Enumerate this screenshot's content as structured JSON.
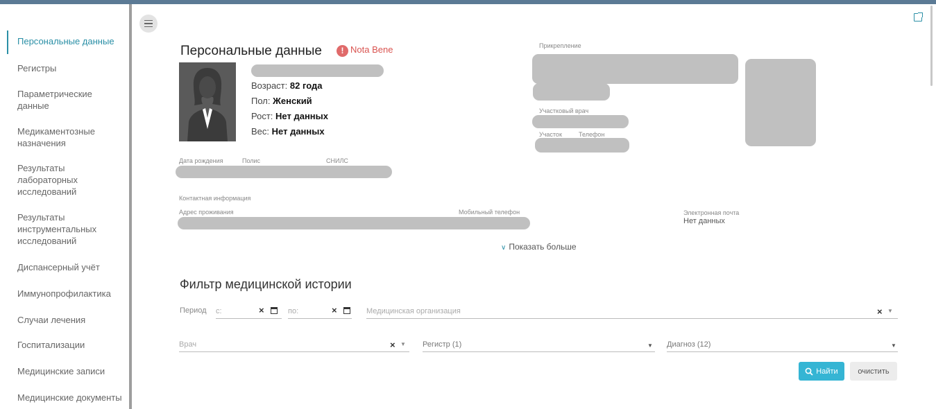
{
  "sidebar": {
    "items": [
      {
        "label": "Персональные данные"
      },
      {
        "label": "Регистры"
      },
      {
        "label": "Параметрические данные"
      },
      {
        "label": "Медикаментозные назначения"
      },
      {
        "label": "Результаты лабораторных исследований"
      },
      {
        "label": "Результаты инструментальных исследований"
      },
      {
        "label": "Диспансерный учёт"
      },
      {
        "label": "Иммунопрофилактика"
      },
      {
        "label": "Случаи лечения"
      },
      {
        "label": "Госпитализации"
      },
      {
        "label": "Медицинские записи"
      },
      {
        "label": "Медицинские документы"
      }
    ]
  },
  "personal": {
    "title": "Персональные данные",
    "nota_bene": "Nota Bene",
    "age_label": "Возраст:",
    "age_value": "82 года",
    "sex_label": "Пол:",
    "sex_value": "Женский",
    "height_label": "Рост:",
    "height_value": "Нет данных",
    "weight_label": "Вес:",
    "weight_value": "Нет данных",
    "birth_label": "Дата рождения",
    "policy_label": "Полис",
    "snils_label": "СНИЛС",
    "contact_label": "Контактная информация",
    "address_label": "Адрес проживания",
    "mobile_label": "Мобильный телефон",
    "email_label": "Электронная почта",
    "email_value": "Нет данных",
    "show_more": "Показать больше"
  },
  "attachment": {
    "label": "Прикрепление",
    "doctor_label": "Участковый врач",
    "area_label": "Участок",
    "phone_label": "Телефон"
  },
  "filter": {
    "title": "Фильтр медицинской истории",
    "period_label": "Период",
    "from_placeholder": "с:",
    "to_placeholder": "по:",
    "org_placeholder": "Медицинская организация",
    "doctor_placeholder": "Врач",
    "registry_value": "Регистр (1)",
    "diagnosis_value": "Диагноз (12)",
    "find_button": "Найти",
    "clear_button": "очистить"
  },
  "colors": {
    "accent": "#2a8fa6",
    "button": "#35b5d4",
    "nota_bene": "#d9534f"
  }
}
